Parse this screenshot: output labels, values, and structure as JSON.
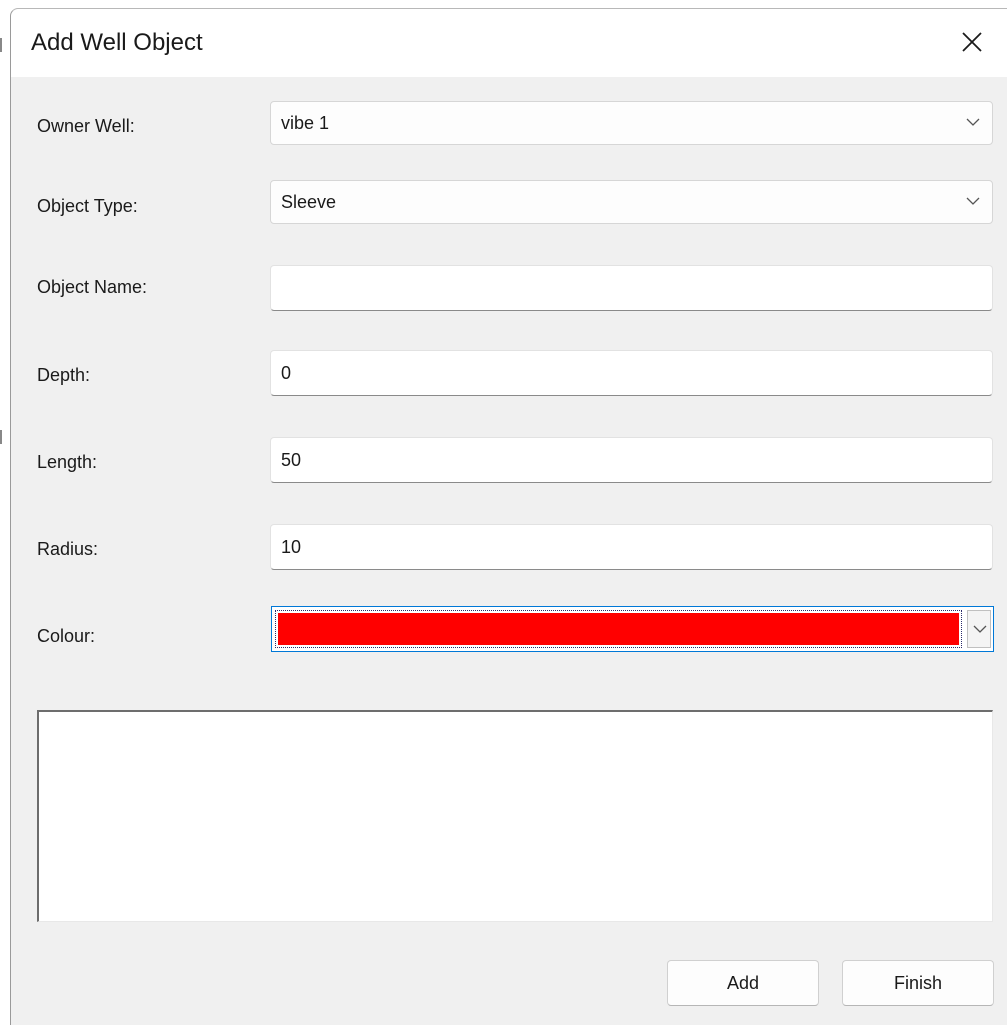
{
  "window": {
    "title": "Add Well Object",
    "close_icon": "close-icon"
  },
  "form": {
    "owner_well": {
      "label": "Owner Well:",
      "value": "vibe 1"
    },
    "object_type": {
      "label": "Object Type:",
      "value": "Sleeve"
    },
    "object_name": {
      "label": "Object Name:",
      "value": ""
    },
    "depth": {
      "label": "Depth:",
      "value": "0"
    },
    "length": {
      "label": "Length:",
      "value": "50"
    },
    "radius": {
      "label": "Radius:",
      "value": "10"
    },
    "colour": {
      "label": "Colour:",
      "value_hex": "#ff0000"
    }
  },
  "notes": {
    "value": ""
  },
  "buttons": {
    "add_label": "Add",
    "finish_label": "Finish"
  },
  "colors": {
    "window_bg": "#f0f0f0",
    "titlebar_bg": "#ffffff",
    "focus_accent": "#0078d7"
  }
}
